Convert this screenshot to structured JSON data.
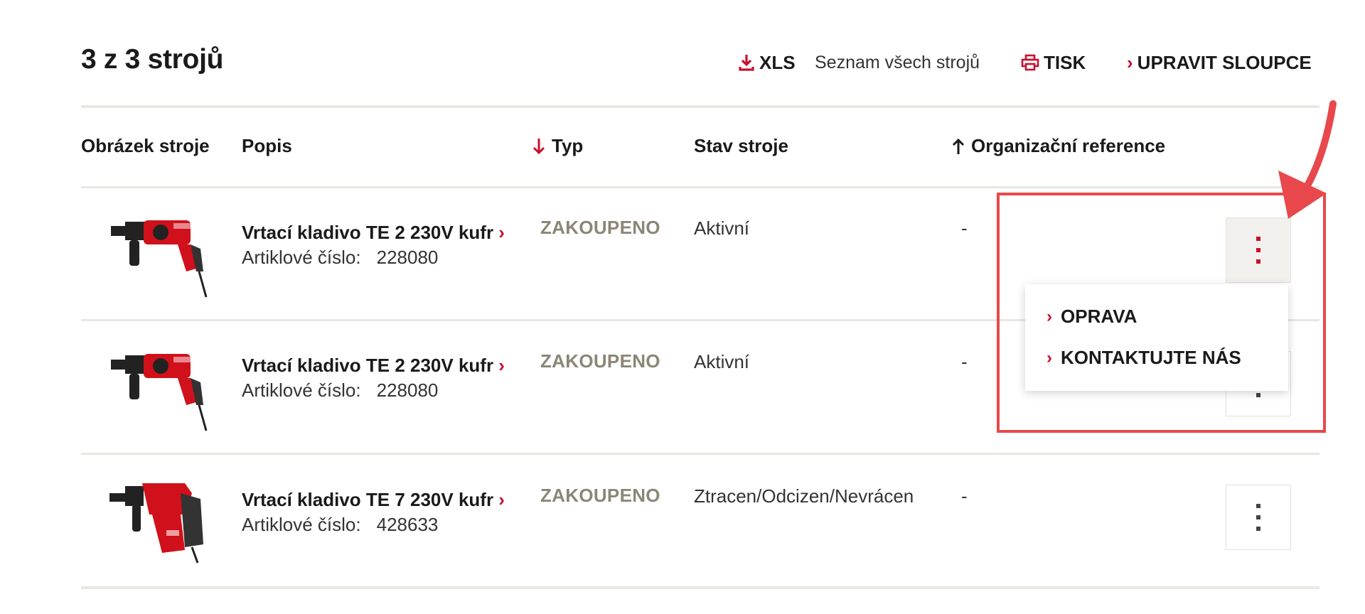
{
  "header": {
    "title": "3 z 3 strojů",
    "xls_label": "XLS",
    "all_machines_link": "Seznam všech strojů",
    "print_label": "TISK",
    "edit_columns_label": "UPRAVIT SLOUPCE"
  },
  "table": {
    "columns": {
      "image": "Obrázek stroje",
      "description": "Popis",
      "type": "Typ",
      "status": "Stav stroje",
      "org_ref": "Organizační reference"
    },
    "article_label": "Artiklové číslo:",
    "rows": [
      {
        "name": "Vrtací kladivo TE 2 230V kufr",
        "article": "228080",
        "type": "ZAKOUPENO",
        "status": "Aktivní",
        "org_ref": "-"
      },
      {
        "name": "Vrtací kladivo TE 2 230V kufr",
        "article": "228080",
        "type": "ZAKOUPENO",
        "status": "Aktivní",
        "org_ref": "-"
      },
      {
        "name": "Vrtací kladivo TE 7 230V kufr",
        "article": "428633",
        "type": "ZAKOUPENO",
        "status": "Ztracen/Odcizen/Nevrácen",
        "org_ref": "-"
      }
    ]
  },
  "dropdown": {
    "items": [
      {
        "label": "OPRAVA"
      },
      {
        "label": "KONTAKTUJTE NÁS"
      }
    ]
  },
  "colors": {
    "accent": "#c8102e",
    "type_text": "#8b8676",
    "divider": "#e9e7e1",
    "annotation": "#e8484b"
  },
  "icons": {
    "xls": "download-icon",
    "print": "printer-icon",
    "edit": "chevron-right-icon",
    "sort_type": "arrow-down-icon",
    "sort_org": "arrow-up-icon",
    "row_menu": "kebab-menu-icon"
  }
}
